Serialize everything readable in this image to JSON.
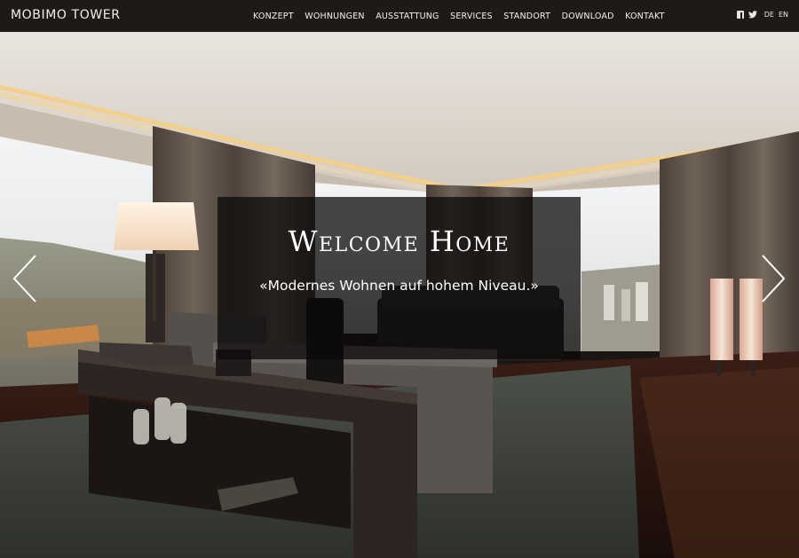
{
  "header": {
    "brand": "MOBIMO TOWER",
    "nav": [
      "KONZEPT",
      "WOHNUNGEN",
      "AUSSTATTUNG",
      "SERVICES",
      "STANDORT",
      "DOWNLOAD",
      "KONTAKT"
    ],
    "lang_de": "DE",
    "lang_en": "EN"
  },
  "hero": {
    "title": "Welcome Home",
    "subtitle": "«Modernes Wohnen auf hohem Niveau.»"
  },
  "colors": {
    "topbar": "#1e1a18",
    "caption_bg": "#0a0808"
  },
  "icons": [
    "facebook-icon",
    "twitter-icon",
    "chevron-left-icon",
    "chevron-right-icon"
  ]
}
